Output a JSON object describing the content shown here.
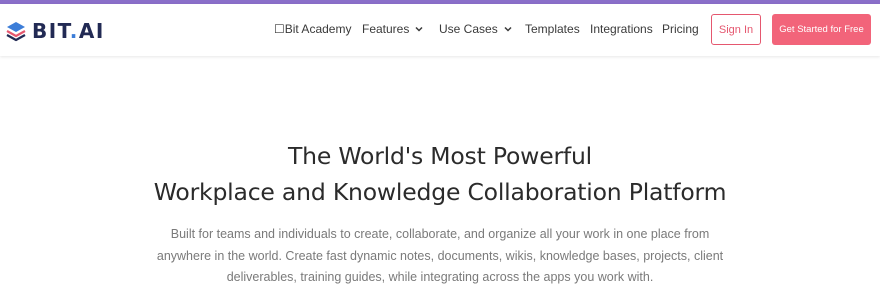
{
  "colors": {
    "top_strip": "#8a6fc9",
    "brand_navy": "#222a54",
    "brand_blue": "#3c7dd8",
    "accent_pink": "#f2647a",
    "sign_in_border": "#e5576f"
  },
  "logo": {
    "name": "BIT",
    "dot": ".",
    "suffix": "AI",
    "icon": "stacked-layers-icon"
  },
  "nav": {
    "items": [
      {
        "label": "☐Bit Academy",
        "has_dropdown": false
      },
      {
        "label": "Features",
        "has_dropdown": true
      },
      {
        "label": "Use Cases",
        "has_dropdown": true
      },
      {
        "label": "Templates",
        "has_dropdown": false
      },
      {
        "label": "Integrations",
        "has_dropdown": false
      },
      {
        "label": "Pricing",
        "has_dropdown": false
      }
    ],
    "sign_in": "Sign In",
    "get_started": "Get Started for Free"
  },
  "hero": {
    "title_line1": "The World's Most Powerful",
    "title_line2": "Workplace and Knowledge Collaboration Platform",
    "subtitle_line1": "Built for teams and individuals to create, collaborate, and organize all your work in one place from",
    "subtitle_line2": "anywhere in the world. Create fast dynamic notes, documents, wikis, knowledge bases, projects, client",
    "subtitle_line3": "deliverables, training guides, while integrating across the apps you work with."
  }
}
